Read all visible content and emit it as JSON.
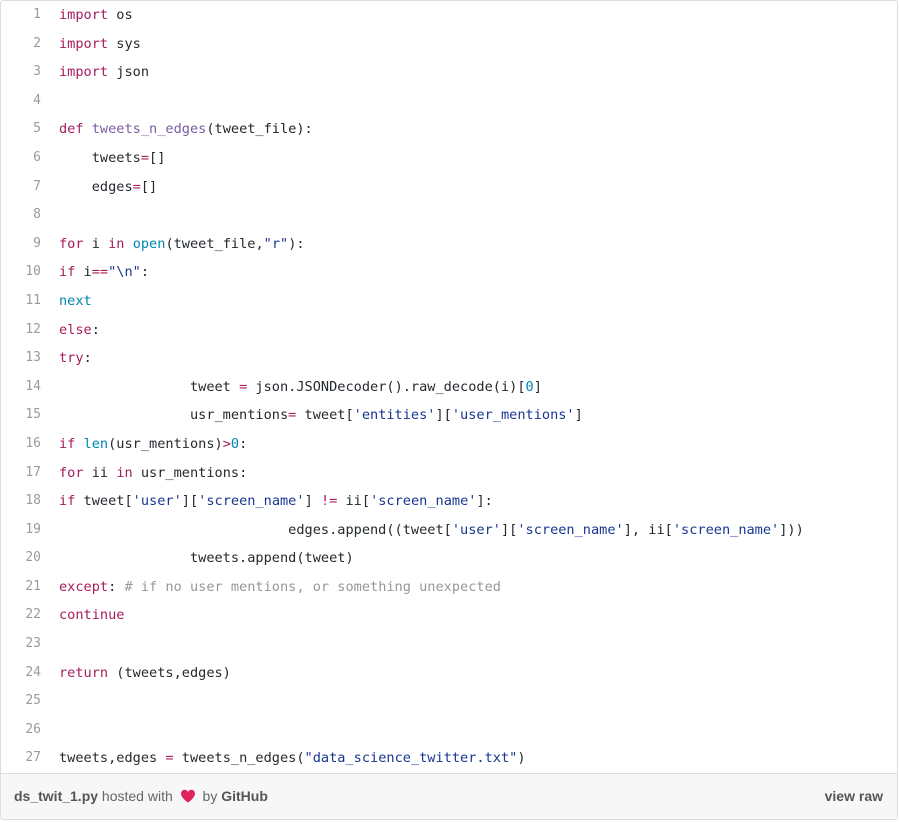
{
  "code_lines": [
    {
      "n": "1",
      "tokens": [
        {
          "c": "kw",
          "t": "import"
        },
        {
          "c": "",
          "t": " os"
        }
      ]
    },
    {
      "n": "2",
      "tokens": [
        {
          "c": "kw",
          "t": "import"
        },
        {
          "c": "",
          "t": " sys"
        }
      ]
    },
    {
      "n": "3",
      "tokens": [
        {
          "c": "kw",
          "t": "import"
        },
        {
          "c": "",
          "t": " json"
        }
      ]
    },
    {
      "n": "4",
      "tokens": []
    },
    {
      "n": "5",
      "tokens": [
        {
          "c": "kw",
          "t": "def"
        },
        {
          "c": "",
          "t": " "
        },
        {
          "c": "fn",
          "t": "tweets_n_edges"
        },
        {
          "c": "",
          "t": "(tweet_file):"
        }
      ]
    },
    {
      "n": "6",
      "tokens": [
        {
          "c": "",
          "t": "    tweets"
        },
        {
          "c": "kw",
          "t": "="
        },
        {
          "c": "",
          "t": "[]"
        }
      ]
    },
    {
      "n": "7",
      "tokens": [
        {
          "c": "",
          "t": "    edges"
        },
        {
          "c": "kw",
          "t": "="
        },
        {
          "c": "",
          "t": "[]"
        }
      ]
    },
    {
      "n": "8",
      "tokens": []
    },
    {
      "n": "9",
      "tokens": [
        {
          "c": "kw",
          "t": "for"
        },
        {
          "c": "",
          "t": " i "
        },
        {
          "c": "kw",
          "t": "in"
        },
        {
          "c": "",
          "t": " "
        },
        {
          "c": "bi",
          "t": "open"
        },
        {
          "c": "",
          "t": "(tweet_file,"
        },
        {
          "c": "str",
          "t": "\"r\""
        },
        {
          "c": "",
          "t": "):"
        }
      ]
    },
    {
      "n": "10",
      "tokens": [
        {
          "c": "kw",
          "t": "if"
        },
        {
          "c": "",
          "t": " i"
        },
        {
          "c": "kw",
          "t": "=="
        },
        {
          "c": "str",
          "t": "\"\\n\""
        },
        {
          "c": "",
          "t": ":"
        }
      ]
    },
    {
      "n": "11",
      "tokens": [
        {
          "c": "bi",
          "t": "next"
        }
      ]
    },
    {
      "n": "12",
      "tokens": [
        {
          "c": "kw",
          "t": "else"
        },
        {
          "c": "",
          "t": ":"
        }
      ]
    },
    {
      "n": "13",
      "tokens": [
        {
          "c": "kw",
          "t": "try"
        },
        {
          "c": "",
          "t": ":"
        }
      ]
    },
    {
      "n": "14",
      "tokens": [
        {
          "c": "",
          "t": "                tweet "
        },
        {
          "c": "kw",
          "t": "="
        },
        {
          "c": "",
          "t": " json.JSONDecoder().raw_decode(i)["
        },
        {
          "c": "bi",
          "t": "0"
        },
        {
          "c": "",
          "t": "]"
        }
      ]
    },
    {
      "n": "15",
      "tokens": [
        {
          "c": "",
          "t": "                usr_mentions"
        },
        {
          "c": "kw",
          "t": "="
        },
        {
          "c": "",
          "t": " tweet["
        },
        {
          "c": "str",
          "t": "'entities'"
        },
        {
          "c": "",
          "t": "]["
        },
        {
          "c": "str",
          "t": "'user_mentions'"
        },
        {
          "c": "",
          "t": "]"
        }
      ]
    },
    {
      "n": "16",
      "tokens": [
        {
          "c": "kw",
          "t": "if"
        },
        {
          "c": "",
          "t": " "
        },
        {
          "c": "bi",
          "t": "len"
        },
        {
          "c": "",
          "t": "(usr_mentions)"
        },
        {
          "c": "kw",
          "t": ">"
        },
        {
          "c": "bi",
          "t": "0"
        },
        {
          "c": "",
          "t": ":"
        }
      ]
    },
    {
      "n": "17",
      "tokens": [
        {
          "c": "kw",
          "t": "for"
        },
        {
          "c": "",
          "t": " ii "
        },
        {
          "c": "kw",
          "t": "in"
        },
        {
          "c": "",
          "t": " usr_mentions:"
        }
      ]
    },
    {
      "n": "18",
      "tokens": [
        {
          "c": "kw",
          "t": "if"
        },
        {
          "c": "",
          "t": " tweet["
        },
        {
          "c": "str",
          "t": "'user'"
        },
        {
          "c": "",
          "t": "]["
        },
        {
          "c": "str",
          "t": "'screen_name'"
        },
        {
          "c": "",
          "t": "] "
        },
        {
          "c": "kw",
          "t": "!="
        },
        {
          "c": "",
          "t": " ii["
        },
        {
          "c": "str",
          "t": "'screen_name'"
        },
        {
          "c": "",
          "t": "]:"
        }
      ]
    },
    {
      "n": "19",
      "tokens": [
        {
          "c": "",
          "t": "                            edges.append((tweet["
        },
        {
          "c": "str",
          "t": "'user'"
        },
        {
          "c": "",
          "t": "]["
        },
        {
          "c": "str",
          "t": "'screen_name'"
        },
        {
          "c": "",
          "t": "], ii["
        },
        {
          "c": "str",
          "t": "'screen_name'"
        },
        {
          "c": "",
          "t": "]))"
        }
      ]
    },
    {
      "n": "20",
      "tokens": [
        {
          "c": "",
          "t": "                tweets.append(tweet)"
        }
      ]
    },
    {
      "n": "21",
      "tokens": [
        {
          "c": "kw",
          "t": "except"
        },
        {
          "c": "",
          "t": ": "
        },
        {
          "c": "com",
          "t": "# if no user mentions, or something unexpected"
        }
      ]
    },
    {
      "n": "22",
      "tokens": [
        {
          "c": "kw",
          "t": "continue"
        }
      ]
    },
    {
      "n": "23",
      "tokens": []
    },
    {
      "n": "24",
      "tokens": [
        {
          "c": "kw",
          "t": "return"
        },
        {
          "c": "",
          "t": " (tweets,edges)"
        }
      ]
    },
    {
      "n": "25",
      "tokens": []
    },
    {
      "n": "26",
      "tokens": []
    },
    {
      "n": "27",
      "tokens": [
        {
          "c": "",
          "t": "tweets,edges "
        },
        {
          "c": "kw",
          "t": "="
        },
        {
          "c": "",
          "t": " tweets_n_edges("
        },
        {
          "c": "str",
          "t": "\"data_science_twitter.txt\""
        },
        {
          "c": "",
          "t": ")"
        }
      ]
    }
  ],
  "footer": {
    "filename": "ds_twit_1.py",
    "hosted_with": "hosted with",
    "by": "by",
    "host": "GitHub",
    "view_raw": "view raw"
  },
  "colors": {
    "keyword": "#a71d5d",
    "function": "#795da3",
    "builtin": "#0086b3",
    "string": "#183691",
    "comment": "#969896",
    "heart": "#e0245e"
  },
  "icons": {
    "heart": "heart-icon"
  }
}
